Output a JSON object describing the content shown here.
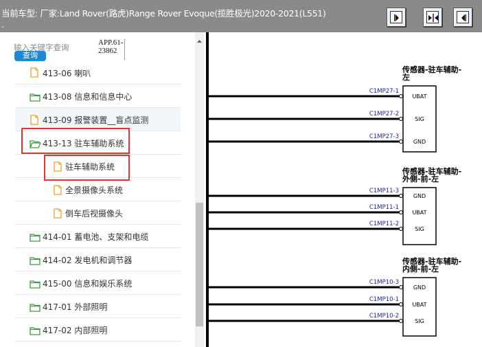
{
  "window": {
    "title": "当前车型:  厂家:Land Rover(路虎)Range Rover Evoque(揽胜极光)2020-2021(L551)",
    "title_tick": "-"
  },
  "toolbar": {
    "buttons": [
      {
        "name": "toolbar-button-expand-right",
        "icon": "arrow-right-icon"
      },
      {
        "name": "toolbar-button-split",
        "icon": "split-arrows-icon"
      },
      {
        "name": "toolbar-button-expand-left",
        "icon": "arrow-left-icon"
      }
    ]
  },
  "search": {
    "placeholder": "输入关键字查询",
    "button_label": "查询",
    "app_code": "APP.61-23862"
  },
  "tree": {
    "items": [
      {
        "label": "413-06 喇叭",
        "icon": "document-icon",
        "level": 1
      },
      {
        "label": "413-08 信息和信息中心",
        "icon": "folder-icon",
        "level": 0
      },
      {
        "label": "413-09 报警装置__盲点监测",
        "icon": "document-icon",
        "level": 1
      },
      {
        "label": "413-13 驻车辅助系统",
        "icon": "folder-open-icon",
        "level": 0
      },
      {
        "label": "驻车辅助系统",
        "icon": "document-icon",
        "level": 2
      },
      {
        "label": "全景摄像头系统",
        "icon": "document-icon",
        "level": 2
      },
      {
        "label": "倒车后视摄像头",
        "icon": "document-icon",
        "level": 2
      },
      {
        "label": "414-01 蓄电池、支架和电缆",
        "icon": "folder-icon",
        "level": 0
      },
      {
        "label": "414-02 发电机和调节器",
        "icon": "folder-icon",
        "level": 0
      },
      {
        "label": "415-00 信息和娱乐系统",
        "icon": "folder-icon",
        "level": 0
      },
      {
        "label": "417-01 外部照明",
        "icon": "folder-icon",
        "level": 0
      },
      {
        "label": "417-02 内部照明",
        "icon": "folder-icon",
        "level": 0
      }
    ]
  },
  "diagram": {
    "components": [
      {
        "title_line1": "传感器-驻车辅助-",
        "title_line2": "左",
        "title_line3": "",
        "pins": [
          {
            "connector": "C1MP27-1",
            "signal": "UBAT"
          },
          {
            "connector": "C1MP27-2",
            "signal": "SIG"
          },
          {
            "connector": "C1MP27-3",
            "signal": "GND"
          }
        ]
      },
      {
        "title_line1": "传感器-驻车辅助-",
        "title_line2": "外侧-前-左",
        "title_line3": "",
        "pins": [
          {
            "connector": "C1MP11-3",
            "signal": "GND"
          },
          {
            "connector": "C1MP11-1",
            "signal": "UBAT"
          },
          {
            "connector": "C1MP11-2",
            "signal": "SIG"
          }
        ]
      },
      {
        "title_line1": "传感器-驻车辅助-",
        "title_line2": "内侧-前-左",
        "title_line3": "",
        "pins": [
          {
            "connector": "C1MP10-3",
            "signal": "GND"
          },
          {
            "connector": "C1MP10-1",
            "signal": "UBAT"
          },
          {
            "connector": "C1MP10-2",
            "signal": "SIG"
          }
        ]
      }
    ]
  },
  "colors": {
    "connector_label": "#1a1aa8",
    "highlight_box": "#e0342e",
    "folder_green": "#3c9a3c",
    "document_orange": "#f0a020",
    "search_button": "#1e88d8"
  }
}
